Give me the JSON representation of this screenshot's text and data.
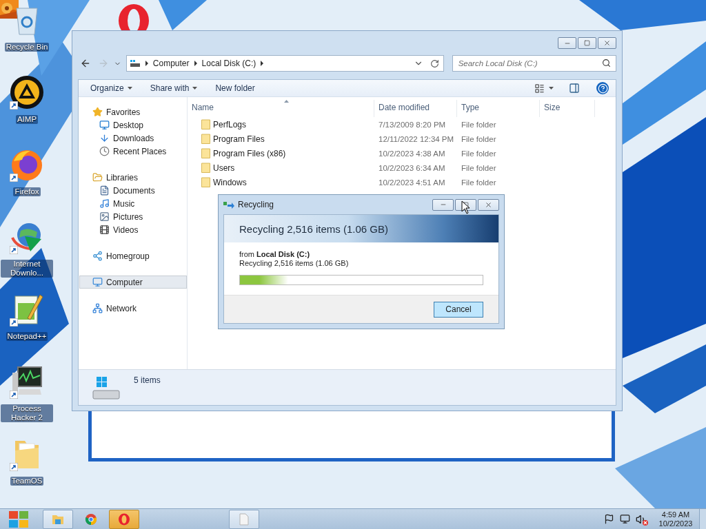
{
  "desktop_icons": [
    {
      "label": "Recycle Bin",
      "kind": "recycle",
      "shortcut": false
    },
    {
      "label": "AIMP",
      "kind": "aimp",
      "shortcut": true
    },
    {
      "label": "Firefox",
      "kind": "firefox",
      "shortcut": true
    },
    {
      "label": "Internet Downlo...",
      "kind": "downloader",
      "shortcut": true
    },
    {
      "label": "Notepad++",
      "kind": "notepad",
      "shortcut": true
    },
    {
      "label": "Process Hacker 2",
      "kind": "monitor",
      "shortcut": true
    },
    {
      "label": "TeamOS",
      "kind": "folder",
      "shortcut": true
    }
  ],
  "explorer": {
    "breadcrumb": [
      "Computer",
      "Local Disk (C:)"
    ],
    "search": {
      "placeholder": "Search Local Disk (C:)"
    },
    "toolbar": [
      {
        "label": "Organize",
        "dropdown": true
      },
      {
        "label": "Share with",
        "dropdown": true
      },
      {
        "label": "New folder",
        "dropdown": false
      }
    ],
    "sidebar": [
      {
        "label": "Favorites",
        "kind": "star",
        "selected": false,
        "children": [
          {
            "label": "Desktop",
            "kind": "desktop",
            "selected": false
          },
          {
            "label": "Downloads",
            "kind": "download",
            "selected": false
          },
          {
            "label": "Recent Places",
            "kind": "recent",
            "selected": false
          }
        ]
      },
      {
        "label": "Libraries",
        "kind": "library",
        "selected": false,
        "children": [
          {
            "label": "Documents",
            "kind": "document",
            "selected": false
          },
          {
            "label": "Music",
            "kind": "music",
            "selected": false
          },
          {
            "label": "Pictures",
            "kind": "picture",
            "selected": false
          },
          {
            "label": "Videos",
            "kind": "video",
            "selected": false
          }
        ]
      },
      {
        "label": "Homegroup",
        "kind": "homegroup",
        "selected": false
      },
      {
        "label": "Computer",
        "kind": "computer",
        "selected": true
      },
      {
        "label": "Network",
        "kind": "network",
        "selected": false
      }
    ],
    "columns": [
      "Name",
      "Date modified",
      "Type",
      "Size"
    ],
    "rows": [
      {
        "name": "PerfLogs",
        "date": "7/13/2009 8:20 PM",
        "type": "File folder"
      },
      {
        "name": "Program Files",
        "date": "12/11/2022 12:34 PM",
        "type": "File folder"
      },
      {
        "name": "Program Files (x86)",
        "date": "10/2/2023 4:38 AM",
        "type": "File folder"
      },
      {
        "name": "Users",
        "date": "10/2/2023 6:34 AM",
        "type": "File folder"
      },
      {
        "name": "Windows",
        "date": "10/2/2023 4:51 AM",
        "type": "File folder"
      }
    ],
    "status": "5 items"
  },
  "dialog": {
    "title": "Recycling",
    "heading": "Recycling 2,516 items (1.06 GB)",
    "source": "from **Local Disk (C:)**",
    "detail": "Recycling 2,516 items (1.06 GB)",
    "progress": {
      "level": 0.2
    },
    "button": "Cancel"
  },
  "taskbar": {
    "apps": [
      {
        "kind": "explorer",
        "running": true,
        "attention": false
      },
      {
        "kind": "chrome",
        "running": false,
        "attention": false
      },
      {
        "kind": "opera",
        "running": true,
        "attention": true
      },
      {
        "kind": "document",
        "running": true,
        "attention": false
      }
    ],
    "tray": {
      "muted": true
    },
    "time": "4:59 AM",
    "date": "10/2/2023"
  }
}
